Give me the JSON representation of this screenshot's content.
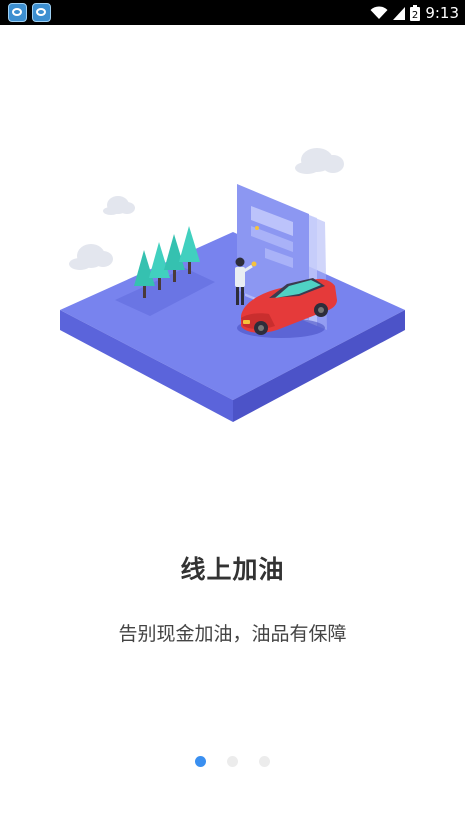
{
  "status_bar": {
    "time": "9:13",
    "battery": "2"
  },
  "slide": {
    "title": "线上加油",
    "subtitle": "告别现金加油，油品有保障"
  },
  "pager": {
    "count": 3,
    "active_index": 0
  },
  "colors": {
    "platform": "#6d7af0",
    "accent": "#3a8ff0",
    "car": "#e53a3a"
  }
}
